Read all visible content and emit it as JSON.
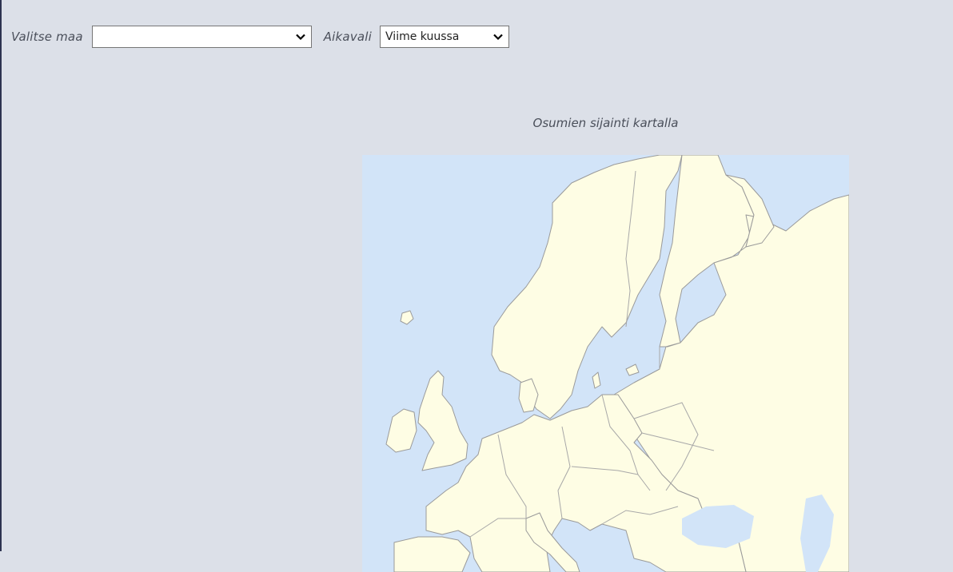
{
  "filters": {
    "country_label": "Valitse maa",
    "country_value": "",
    "period_label": "Aikavali",
    "period_value": "Viime kuussa"
  },
  "map": {
    "title": "Osumien sijainti kartalla",
    "sea_color": "#d2e4f8",
    "land_color": "#fefde4",
    "border_color": "#9a9a9a"
  }
}
